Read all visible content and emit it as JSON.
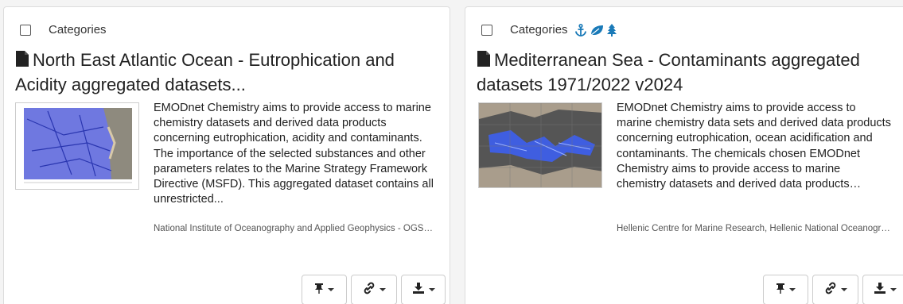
{
  "cards": [
    {
      "categories_label": "Categories",
      "category_icons": [],
      "title": "North East Atlantic Ocean - Eutrophication and Acidity aggregated datasets...",
      "description": "EMODnet Chemistry aims to provide access to marine chemistry datasets and derived data products concerning eutrophication, acidity and contaminants. The importance of the selected substances and other parameters relates to the Marine Strategy Framework Directive (MSFD). This aggregated dataset contains all unrestricted...",
      "organization": "National Institute of Oceanography and Applied Geophysics - OGS, NODC...",
      "buttons": [
        "pin-menu",
        "link-menu",
        "download-menu"
      ]
    },
    {
      "categories_label": "Categories",
      "category_icons": [
        "anchor-icon",
        "leaf-icon",
        "tree-icon"
      ],
      "title": "Mediterranean Sea - Contaminants aggregated datasets 1971/2022 v2024",
      "description": "EMODnet Chemistry aims to provide access to marine chemistry data sets and derived data products concerning eutrophication, ocean acidification and contaminants. The chemicals chosen EMODnet Chemistry aims to provide access to marine chemistry datasets and derived data products concerning eutrophication, acidity...",
      "organization": "Hellenic Centre for Marine Research, Hellenic National Oceanographic Data Centre...",
      "buttons": [
        "pin-menu",
        "link-menu",
        "download-menu"
      ]
    }
  ],
  "colors": {
    "category_icon": "#1a7ab8",
    "text": "#222222",
    "muted": "#555555"
  }
}
